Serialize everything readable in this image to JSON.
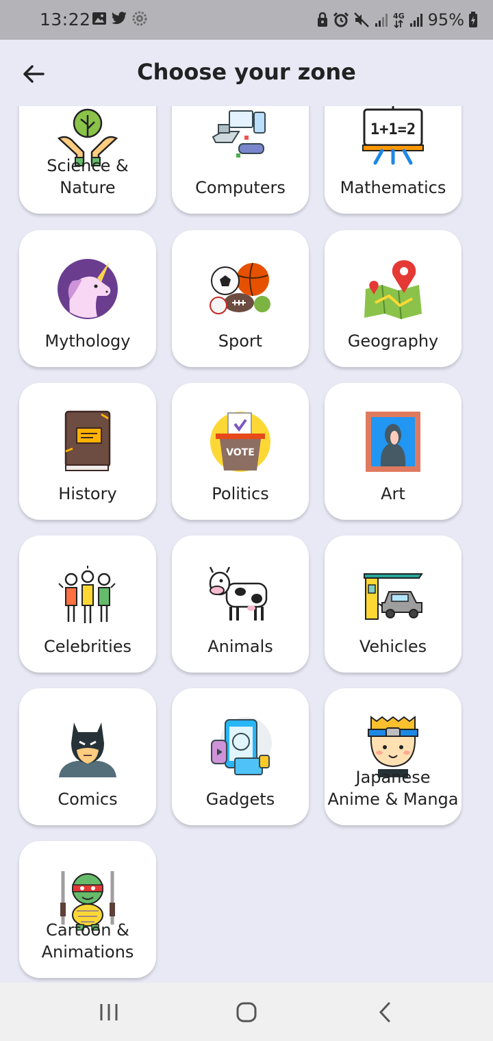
{
  "status_bar": {
    "time": "13:22",
    "battery_text": "95%",
    "network_label": "4G",
    "left_icons": [
      "gallery-icon",
      "twitter-icon",
      "settings-badge-icon"
    ],
    "right_icons": [
      "lock-icon",
      "alarm-icon",
      "mute-icon",
      "signal-icon",
      "4g-icon",
      "signal-icon",
      "battery-icon"
    ]
  },
  "header": {
    "title": "Choose your zone",
    "back_icon": "arrow-left-icon"
  },
  "zones": [
    {
      "label": "Science &\nNature",
      "icon": "plant-hands-icon"
    },
    {
      "label": "Computers",
      "icon": "devices-icon"
    },
    {
      "label": "Mathematics",
      "icon": "whiteboard-icon",
      "icon_text": "1+1=2"
    },
    {
      "label": "Mythology",
      "icon": "unicorn-icon"
    },
    {
      "label": "Sport",
      "icon": "sport-balls-icon"
    },
    {
      "label": "Geography",
      "icon": "map-pin-icon"
    },
    {
      "label": "History",
      "icon": "old-book-icon"
    },
    {
      "label": "Politics",
      "icon": "ballot-box-icon",
      "icon_text": "VOTE"
    },
    {
      "label": "Art",
      "icon": "painting-icon"
    },
    {
      "label": "Celebrities",
      "icon": "people-icon"
    },
    {
      "label": "Animals",
      "icon": "cow-icon"
    },
    {
      "label": "Vehicles",
      "icon": "charging-car-icon"
    },
    {
      "label": "Comics",
      "icon": "bat-mask-icon"
    },
    {
      "label": "Gadgets",
      "icon": "gadgets-icon"
    },
    {
      "label": "Japanese\nAnime & Manga",
      "icon": "anime-boy-icon"
    },
    {
      "label": "Cartoon &\nAnimations",
      "icon": "turtle-icon"
    }
  ],
  "nav": {
    "recent_icon": "recent-apps-icon",
    "home_icon": "home-icon",
    "back_icon": "back-chevron-icon"
  }
}
